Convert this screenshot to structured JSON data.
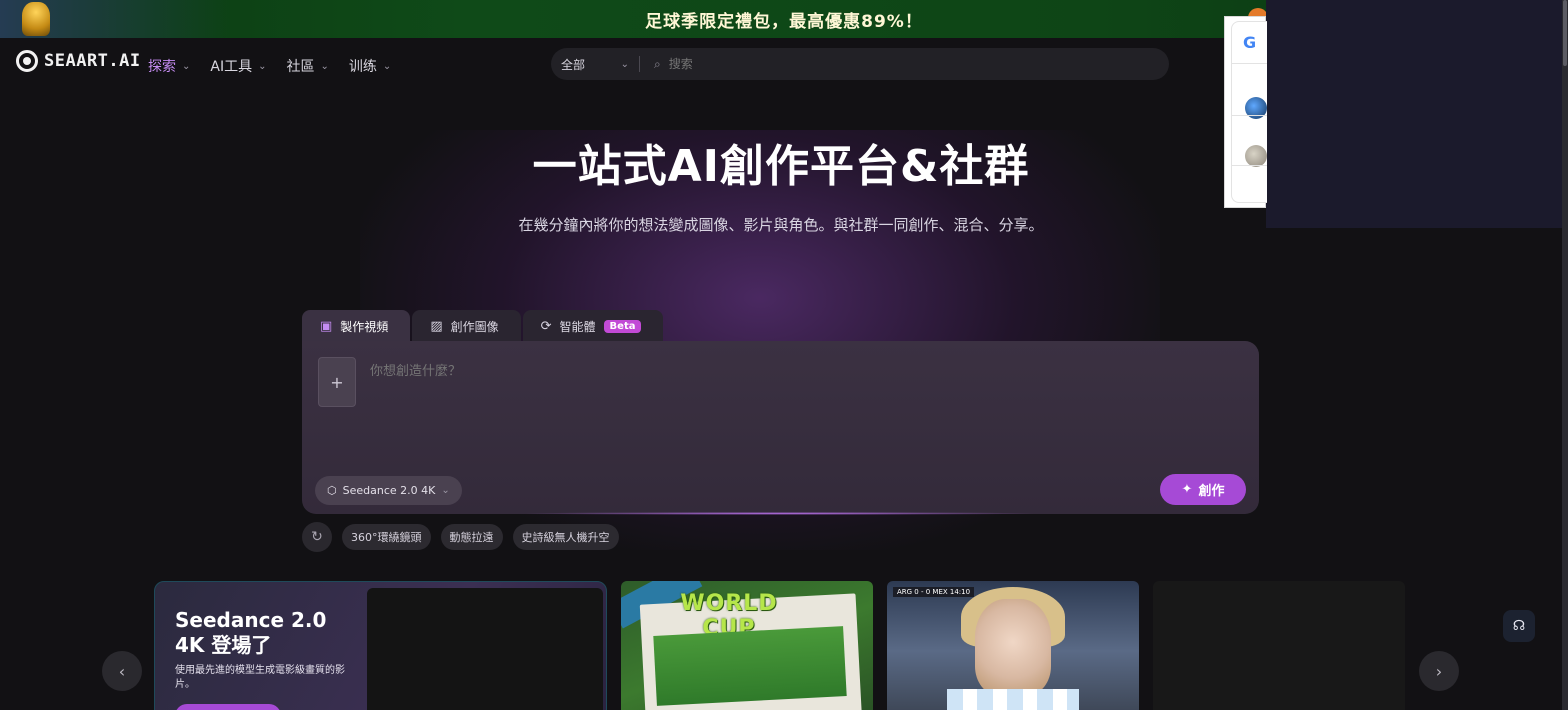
{
  "promo": {
    "text": "足球季限定禮包，最高優惠89%！"
  },
  "brand": {
    "name": "SEAART.AI"
  },
  "nav": {
    "items": [
      {
        "label": "探索",
        "active": true
      },
      {
        "label": "AI工具",
        "active": false
      },
      {
        "label": "社區",
        "active": false
      },
      {
        "label": "训练",
        "active": false
      }
    ]
  },
  "search": {
    "scope": "全部",
    "placeholder": "搜索"
  },
  "google_popup": {
    "logo": "G"
  },
  "hero": {
    "title": "一站式AI創作平台&社群",
    "subtitle": "在幾分鐘內將你的想法變成圖像、影片與角色。與社群一同創作、混合、分享。"
  },
  "tabs": [
    {
      "label": "製作視頻",
      "icon": "video-icon",
      "active": true
    },
    {
      "label": "創作圖像",
      "icon": "image-icon",
      "active": false
    },
    {
      "label": "智能體",
      "icon": "agent-icon",
      "active": false,
      "badge": "Beta"
    }
  ],
  "prompt": {
    "add_label": "+",
    "placeholder": "你想創造什麼？",
    "model": "Seedance 2.0 4K",
    "create_label": "創作"
  },
  "suggestions": [
    "360°環繞鏡頭",
    "動態拉遠",
    "史詩級無人機升空"
  ],
  "carousel": {
    "feature": {
      "title": "Seedance 2.0 4K 登場了",
      "description": "使用最先進的模型生成電影級畫質的影片。"
    },
    "worldcup": {
      "title": "WORLD CUP"
    },
    "fan": {
      "score": "ARG 0 - 0 MEX  14:10"
    }
  },
  "colors": {
    "accent": "#a64ad6",
    "accent_text": "#c58cf2",
    "background": "#121114",
    "promo_bg": "#0f4a18"
  }
}
